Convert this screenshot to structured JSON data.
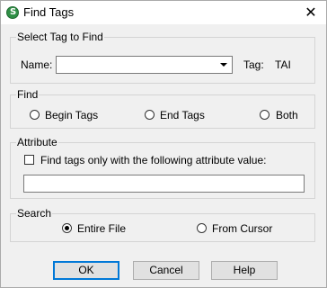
{
  "window": {
    "title": "Find Tags",
    "close_glyph": "✕",
    "app_icon_letter": "S"
  },
  "select_group": {
    "legend": "Select Tag to Find",
    "name_label": "Name:",
    "name_value": "",
    "tag_label": "Tag:",
    "tag_value": "TAI"
  },
  "find_group": {
    "legend": "Find",
    "options": [
      {
        "label": "Begin Tags",
        "selected": false
      },
      {
        "label": "End Tags",
        "selected": false
      },
      {
        "label": "Both",
        "selected": false
      }
    ]
  },
  "attribute_group": {
    "legend": "Attribute",
    "checkbox_label": "Find tags only with the following attribute value:",
    "checked": false,
    "value": ""
  },
  "search_group": {
    "legend": "Search",
    "options": [
      {
        "label": "Entire File",
        "selected": true
      },
      {
        "label": "From Cursor",
        "selected": false
      }
    ]
  },
  "buttons": {
    "ok": "OK",
    "cancel": "Cancel",
    "help": "Help"
  }
}
